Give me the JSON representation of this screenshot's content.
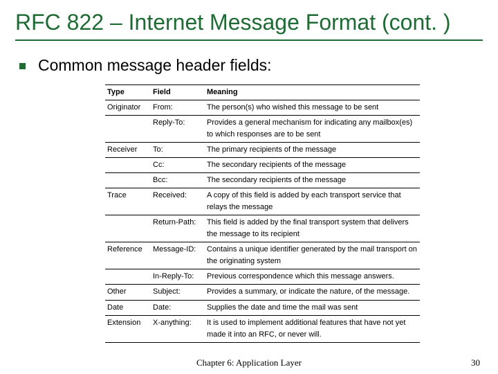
{
  "title": "RFC 822 – Internet Message Format (cont. )",
  "bullet": "Common message header fields:",
  "table": {
    "head": {
      "type": "Type",
      "field": "Field",
      "meaning": "Meaning"
    },
    "rows": [
      {
        "type": "Originator",
        "field": "From:",
        "meaning": "The person(s) who wished this message to be sent"
      },
      {
        "type": "",
        "field": "Reply-To:",
        "meaning": "Provides a general mechanism for indicating any mailbox(es) to which responses are to be sent"
      },
      {
        "type": "Receiver",
        "field": "To:",
        "meaning": "The primary recipients of the message"
      },
      {
        "type": "",
        "field": "Cc:",
        "meaning": "The secondary recipients of the message"
      },
      {
        "type": "",
        "field": "Bcc:",
        "meaning": "The secondary recipients of the message"
      },
      {
        "type": "Trace",
        "field": "Received:",
        "meaning": "A copy of this field is added by each transport service that relays the message"
      },
      {
        "type": "",
        "field": "Return-Path:",
        "meaning": "This field is added by the final transport system that delivers the message to its recipient"
      },
      {
        "type": "Reference",
        "field": "Message-ID:",
        "meaning": "Contains a unique identifier generated by the mail transport on the originating system"
      },
      {
        "type": "",
        "field": "In-Reply-To:",
        "meaning": "Previous correspondence which this message answers."
      },
      {
        "type": "Other",
        "field": "Subject:",
        "meaning": "Provides a summary, or indicate the        nature, of the message."
      },
      {
        "type": "Date",
        "field": "Date:",
        "meaning": "Supplies the date and time the mail was sent"
      },
      {
        "type": "Extension",
        "field": "X-anything:",
        "meaning": "It is used to implement additional features that have not yet made it into an RFC, or never will."
      }
    ]
  },
  "footer": {
    "center": "Chapter 6: Application Layer",
    "page": "30"
  }
}
